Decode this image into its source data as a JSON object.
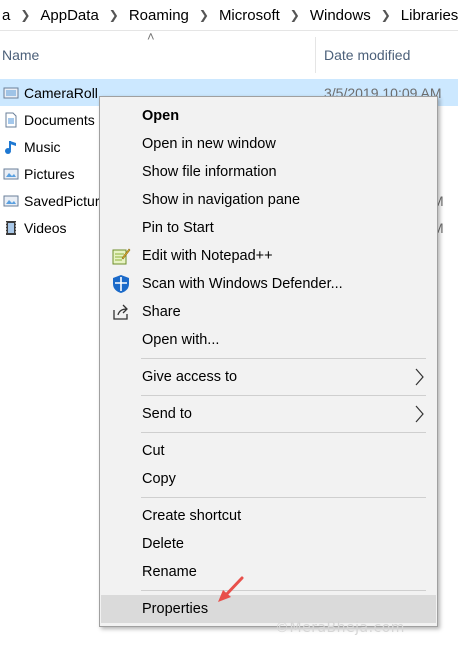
{
  "breadcrumb": [
    "a",
    "AppData",
    "Roaming",
    "Microsoft",
    "Windows",
    "Libraries"
  ],
  "columns": {
    "name": "Name",
    "date_modified": "Date modified"
  },
  "files": [
    {
      "name": "CameraRoll",
      "date": "3/5/2019 10:09 AM",
      "icon": "camera-roll-library-icon",
      "selected": true
    },
    {
      "name": "Documents",
      "date": "",
      "icon": "documents-library-icon"
    },
    {
      "name": "Music",
      "date": "",
      "icon": "music-library-icon"
    },
    {
      "name": "Pictures",
      "date": "",
      "icon": "pictures-library-icon"
    },
    {
      "name": "SavedPictur",
      "date_tail": "M",
      "icon": "saved-pictures-library-icon"
    },
    {
      "name": "Videos",
      "date_tail": "M",
      "icon": "videos-library-icon"
    }
  ],
  "context_menu": {
    "open": "Open",
    "open_new_window": "Open in new window",
    "show_file_info": "Show file information",
    "show_nav_pane": "Show in navigation pane",
    "pin_to_start": "Pin to Start",
    "edit_notepad": "Edit with Notepad++",
    "scan_defender": "Scan with Windows Defender...",
    "share": "Share",
    "open_with": "Open with...",
    "give_access": "Give access to",
    "send_to": "Send to",
    "cut": "Cut",
    "copy": "Copy",
    "create_shortcut": "Create shortcut",
    "delete": "Delete",
    "rename": "Rename",
    "properties": "Properties"
  },
  "watermark": "©MeraBheja.com",
  "colors": {
    "selection": "#cce8ff",
    "menu_bg": "#f2f2f2",
    "menu_hover": "#dadada",
    "annotation_arrow": "#e8504b"
  }
}
